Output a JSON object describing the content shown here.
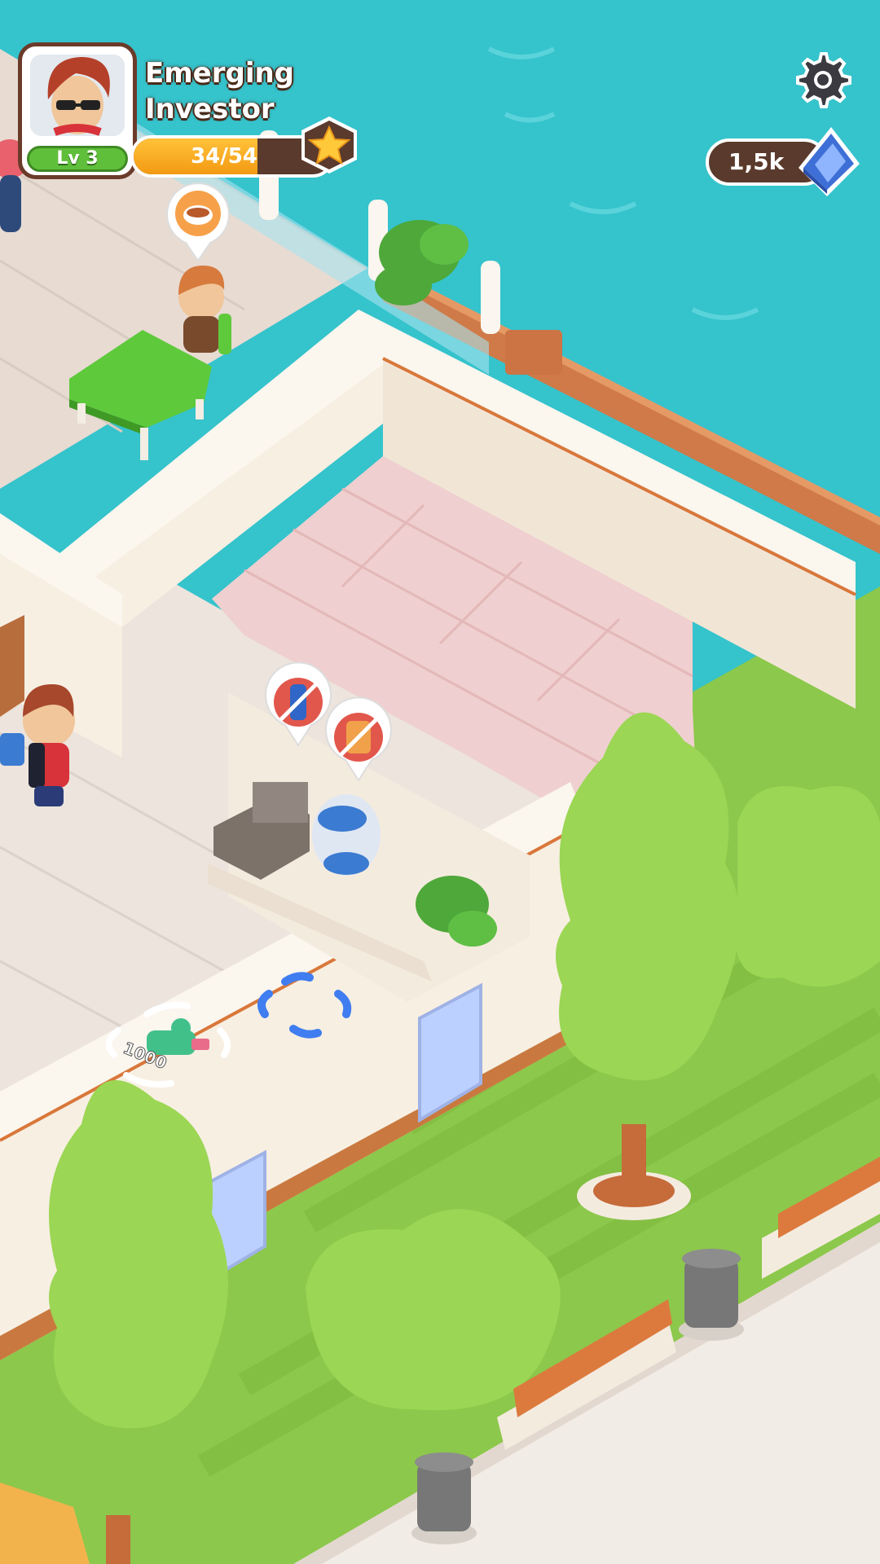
{
  "player": {
    "title_line1": "Emerging",
    "title_line2": "Investor",
    "level_label": "Lv 3",
    "xp_text": "34/54",
    "xp_progress": 0.63
  },
  "currency": {
    "amount": "1,5k",
    "icon": "cash-stack-icon"
  },
  "settings": {
    "icon": "gear-icon"
  },
  "world": {
    "purchase_spot_price": "1000",
    "order_bubbles": [
      "soup-order-icon",
      "water-bottle-request-icon",
      "snack-bag-request-icon"
    ]
  },
  "colors": {
    "water": "#35c3cc",
    "grass": "#8cc84b",
    "wall": "#f7efe2",
    "wall_trim": "#d9773a",
    "floor": "#e8ddd5",
    "pink_floor": "#efcfcf",
    "hud_brown": "#5a3a2c",
    "xp_gold": "#f7a81c",
    "level_green": "#5fbf3a"
  }
}
